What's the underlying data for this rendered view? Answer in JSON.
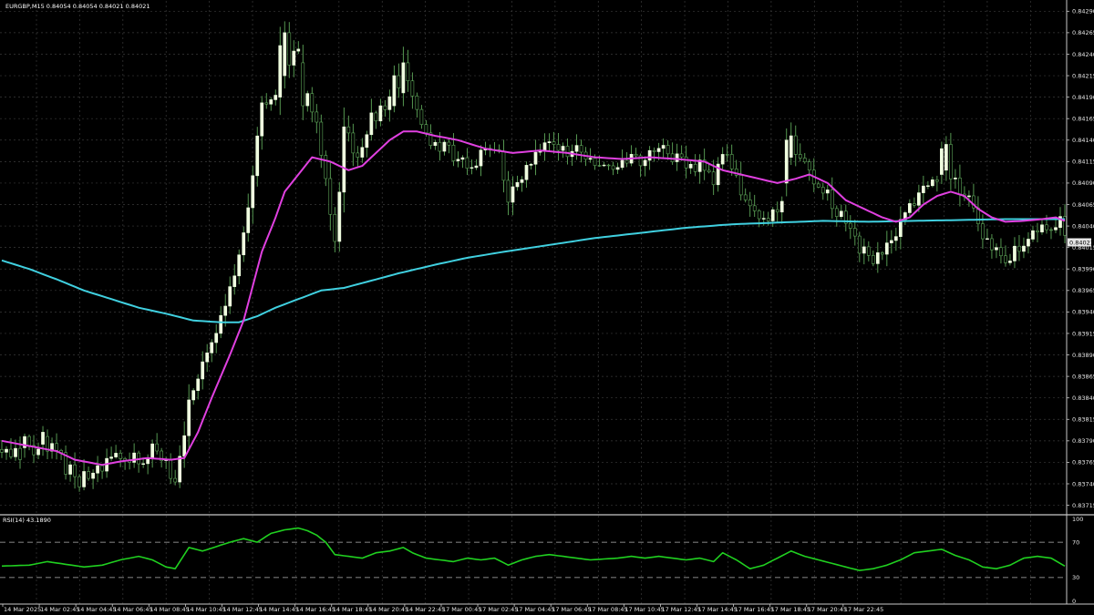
{
  "header": {
    "symbol_info": "EURGBP,M15  0.84054 0.84054 0.84021 0.84021",
    "rsi_info": "RSI(14) 43.1890"
  },
  "colors": {
    "background": "#000000",
    "grid": "#3a3a3a",
    "frame": "#c8c8c8",
    "candle": "#f0ffe0",
    "candle_outline": "#5fa85a",
    "ma_fast": "#e040e0",
    "ma_slow": "#40d0e0",
    "rsi_line": "#20d020",
    "rsi_level": "#b4b4b4",
    "price_marker": "#e6e6e6"
  },
  "chart_data": [
    {
      "type": "candlestick",
      "symbol": "EURGBP",
      "timeframe": "M15",
      "ylim": [
        0.83705,
        0.84302
      ],
      "y_ticks": [
        "0.84290",
        "0.84265",
        "0.84240",
        "0.84215",
        "0.84190",
        "0.84165",
        "0.84140",
        "0.84115",
        "0.84090",
        "0.84065",
        "0.84040",
        "0.84015",
        "0.83990",
        "0.83965",
        "0.83940",
        "0.83915",
        "0.83890",
        "0.83865",
        "0.83840",
        "0.83815",
        "0.83790",
        "0.83765",
        "0.83740",
        "0.83715"
      ],
      "current_price": "0.84021",
      "x_labels": [
        "14 Mar 2025",
        "14 Mar 02:45",
        "14 Mar 04:45",
        "14 Mar 06:45",
        "14 Mar 08:45",
        "14 Mar 10:45",
        "14 Mar 12:45",
        "14 Mar 14:45",
        "14 Mar 16:45",
        "14 Mar 18:45",
        "14 Mar 20:45",
        "14 Mar 22:45",
        "17 Mar 00:45",
        "17 Mar 02:45",
        "17 Mar 04:45",
        "17 Mar 06:45",
        "17 Mar 08:45",
        "17 Mar 10:45",
        "17 Mar 12:45",
        "17 Mar 14:45",
        "17 Mar 16:45",
        "17 Mar 18:45",
        "17 Mar 20:45",
        "17 Mar 22:45"
      ],
      "price_path": [
        [
          0,
          0.8378
        ],
        [
          4,
          0.8377
        ],
        [
          8,
          0.83785
        ],
        [
          11,
          0.8379
        ],
        [
          14,
          0.8376
        ],
        [
          17,
          0.83745
        ],
        [
          21,
          0.83755
        ],
        [
          24,
          0.83772
        ],
        [
          27,
          0.8377
        ],
        [
          30,
          0.83768
        ],
        [
          33,
          0.83778
        ],
        [
          36,
          0.8376
        ],
        [
          38,
          0.83748
        ],
        [
          41,
          0.8383
        ],
        [
          44,
          0.8388
        ],
        [
          47,
          0.8392
        ],
        [
          50,
          0.83965
        ],
        [
          53,
          0.8403
        ],
        [
          55,
          0.841
        ],
        [
          57,
          0.8418
        ],
        [
          60,
          0.842
        ],
        [
          63,
          0.84225
        ],
        [
          65,
          0.8425
        ],
        [
          67,
          0.8419
        ],
        [
          69,
          0.8416
        ],
        [
          71,
          0.8409
        ],
        [
          73,
          0.8402
        ],
        [
          75,
          0.8415
        ],
        [
          78,
          0.8412
        ],
        [
          81,
          0.84165
        ],
        [
          84,
          0.8418
        ],
        [
          87,
          0.842
        ],
        [
          89,
          0.8421
        ],
        [
          91,
          0.8417
        ],
        [
          94,
          0.8414
        ],
        [
          97,
          0.8413
        ],
        [
          100,
          0.8412
        ],
        [
          103,
          0.841
        ],
        [
          106,
          0.8413
        ],
        [
          109,
          0.8412
        ],
        [
          111,
          0.8407
        ],
        [
          114,
          0.841
        ],
        [
          117,
          0.8413
        ],
        [
          120,
          0.8414
        ],
        [
          123,
          0.8413
        ],
        [
          126,
          0.84125
        ],
        [
          129,
          0.8411
        ],
        [
          132,
          0.84105
        ],
        [
          135,
          0.84112
        ],
        [
          138,
          0.8412
        ],
        [
          141,
          0.84115
        ],
        [
          144,
          0.84128
        ],
        [
          147,
          0.8412
        ],
        [
          150,
          0.84112
        ],
        [
          153,
          0.84108
        ],
        [
          156,
          0.84095
        ],
        [
          159,
          0.8413
        ],
        [
          162,
          0.8408
        ],
        [
          165,
          0.8406
        ],
        [
          168,
          0.8405
        ],
        [
          171,
          0.8407
        ],
        [
          174,
          0.8412
        ],
        [
          177,
          0.841
        ],
        [
          180,
          0.8408
        ],
        [
          183,
          0.8406
        ],
        [
          186,
          0.8403
        ],
        [
          189,
          0.8401
        ],
        [
          192,
          0.84
        ],
        [
          195,
          0.8402
        ],
        [
          198,
          0.8405
        ],
        [
          201,
          0.8408
        ],
        [
          204,
          0.8409
        ],
        [
          207,
          0.8411
        ],
        [
          210,
          0.8408
        ],
        [
          213,
          0.8406
        ],
        [
          216,
          0.8402
        ],
        [
          219,
          0.84
        ],
        [
          222,
          0.8401
        ],
        [
          225,
          0.8403
        ],
        [
          228,
          0.8404
        ],
        [
          230,
          0.84035
        ],
        [
          232,
          0.8405
        ],
        [
          233,
          0.84021
        ]
      ],
      "ma_fast_path": [
        [
          0,
          0.8379
        ],
        [
          8,
          0.83782
        ],
        [
          12,
          0.83778
        ],
        [
          16,
          0.83768
        ],
        [
          22,
          0.83762
        ],
        [
          26,
          0.83766
        ],
        [
          32,
          0.8377
        ],
        [
          37,
          0.83768
        ],
        [
          40,
          0.8377
        ],
        [
          43,
          0.838
        ],
        [
          46,
          0.8384
        ],
        [
          50,
          0.8389
        ],
        [
          53,
          0.8393
        ],
        [
          55,
          0.8397
        ],
        [
          57,
          0.8401
        ],
        [
          60,
          0.8405
        ],
        [
          62,
          0.8408
        ],
        [
          65,
          0.841
        ],
        [
          68,
          0.8412
        ],
        [
          72,
          0.84115
        ],
        [
          76,
          0.84105
        ],
        [
          79,
          0.8411
        ],
        [
          82,
          0.84125
        ],
        [
          85,
          0.8414
        ],
        [
          88,
          0.8415
        ],
        [
          91,
          0.8415
        ],
        [
          95,
          0.84145
        ],
        [
          100,
          0.8414
        ],
        [
          106,
          0.8413
        ],
        [
          112,
          0.84125
        ],
        [
          118,
          0.84128
        ],
        [
          124,
          0.84125
        ],
        [
          130,
          0.8412
        ],
        [
          136,
          0.84118
        ],
        [
          142,
          0.8412
        ],
        [
          148,
          0.84118
        ],
        [
          154,
          0.84115
        ],
        [
          158,
          0.84105
        ],
        [
          162,
          0.841
        ],
        [
          166,
          0.84095
        ],
        [
          170,
          0.8409
        ],
        [
          174,
          0.84095
        ],
        [
          177,
          0.841
        ],
        [
          181,
          0.8409
        ],
        [
          185,
          0.8407
        ],
        [
          189,
          0.8406
        ],
        [
          193,
          0.8405
        ],
        [
          196,
          0.84045
        ],
        [
          199,
          0.8405
        ],
        [
          202,
          0.84065
        ],
        [
          205,
          0.84075
        ],
        [
          208,
          0.8408
        ],
        [
          211,
          0.84075
        ],
        [
          214,
          0.8406
        ],
        [
          217,
          0.8405
        ],
        [
          220,
          0.84045
        ],
        [
          224,
          0.84046
        ],
        [
          228,
          0.84048
        ],
        [
          231,
          0.8405
        ],
        [
          233,
          0.84046
        ]
      ],
      "ma_slow_path": [
        [
          0,
          0.84
        ],
        [
          6,
          0.8399
        ],
        [
          12,
          0.83978
        ],
        [
          18,
          0.83965
        ],
        [
          24,
          0.83955
        ],
        [
          30,
          0.83945
        ],
        [
          36,
          0.83938
        ],
        [
          42,
          0.8393
        ],
        [
          48,
          0.83928
        ],
        [
          52,
          0.83928
        ],
        [
          56,
          0.83935
        ],
        [
          60,
          0.83945
        ],
        [
          65,
          0.83955
        ],
        [
          70,
          0.83965
        ],
        [
          75,
          0.83968
        ],
        [
          80,
          0.83975
        ],
        [
          87,
          0.83985
        ],
        [
          95,
          0.83995
        ],
        [
          102,
          0.84003
        ],
        [
          110,
          0.8401
        ],
        [
          120,
          0.84018
        ],
        [
          130,
          0.84026
        ],
        [
          140,
          0.84032
        ],
        [
          150,
          0.84038
        ],
        [
          160,
          0.84042
        ],
        [
          170,
          0.84044
        ],
        [
          180,
          0.84046
        ],
        [
          190,
          0.84045
        ],
        [
          200,
          0.84046
        ],
        [
          210,
          0.84047
        ],
        [
          220,
          0.84048
        ],
        [
          233,
          0.84048
        ]
      ],
      "candles": [
        {
          "i": 5,
          "o": 0.83782,
          "c": 0.83795
        },
        {
          "i": 9,
          "o": 0.83786,
          "c": 0.838
        },
        {
          "i": 10,
          "o": 0.83795,
          "c": 0.83778
        },
        {
          "i": 61,
          "o": 0.8419,
          "c": 0.8425
        },
        {
          "i": 62,
          "o": 0.84215,
          "c": 0.84265
        },
        {
          "i": 66,
          "o": 0.8423,
          "c": 0.8418
        },
        {
          "i": 86,
          "o": 0.8418,
          "c": 0.84215
        },
        {
          "i": 88,
          "o": 0.84195,
          "c": 0.8423
        },
        {
          "i": 172,
          "o": 0.8409,
          "c": 0.8414
        },
        {
          "i": 173,
          "o": 0.8412,
          "c": 0.84145
        },
        {
          "i": 206,
          "o": 0.841,
          "c": 0.8413
        },
        {
          "i": 207,
          "o": 0.84105,
          "c": 0.84135
        }
      ]
    },
    {
      "type": "line",
      "name": "RSI(14)",
      "ylim": [
        0,
        100
      ],
      "y_ticks": [
        "100",
        "70",
        "30",
        "0"
      ],
      "levels": [
        70,
        30
      ],
      "values": [
        [
          0,
          43
        ],
        [
          6,
          44
        ],
        [
          10,
          48
        ],
        [
          14,
          45
        ],
        [
          18,
          42
        ],
        [
          22,
          44
        ],
        [
          26,
          50
        ],
        [
          30,
          54
        ],
        [
          33,
          50
        ],
        [
          36,
          42
        ],
        [
          38,
          40
        ],
        [
          41,
          64
        ],
        [
          44,
          60
        ],
        [
          47,
          65
        ],
        [
          50,
          70
        ],
        [
          53,
          74
        ],
        [
          56,
          70
        ],
        [
          59,
          80
        ],
        [
          62,
          84
        ],
        [
          65,
          86
        ],
        [
          67,
          83
        ],
        [
          69,
          78
        ],
        [
          71,
          70
        ],
        [
          73,
          56
        ],
        [
          76,
          54
        ],
        [
          79,
          52
        ],
        [
          82,
          58
        ],
        [
          85,
          60
        ],
        [
          88,
          64
        ],
        [
          90,
          58
        ],
        [
          93,
          52
        ],
        [
          96,
          50
        ],
        [
          99,
          48
        ],
        [
          102,
          52
        ],
        [
          105,
          50
        ],
        [
          108,
          52
        ],
        [
          111,
          44
        ],
        [
          114,
          50
        ],
        [
          117,
          54
        ],
        [
          120,
          56
        ],
        [
          123,
          54
        ],
        [
          126,
          52
        ],
        [
          129,
          50
        ],
        [
          132,
          51
        ],
        [
          135,
          52
        ],
        [
          138,
          54
        ],
        [
          141,
          52
        ],
        [
          144,
          54
        ],
        [
          147,
          52
        ],
        [
          150,
          50
        ],
        [
          153,
          52
        ],
        [
          156,
          48
        ],
        [
          158,
          58
        ],
        [
          161,
          50
        ],
        [
          164,
          40
        ],
        [
          167,
          44
        ],
        [
          170,
          52
        ],
        [
          173,
          60
        ],
        [
          176,
          54
        ],
        [
          179,
          50
        ],
        [
          182,
          46
        ],
        [
          185,
          42
        ],
        [
          188,
          38
        ],
        [
          191,
          40
        ],
        [
          194,
          44
        ],
        [
          197,
          50
        ],
        [
          200,
          58
        ],
        [
          203,
          60
        ],
        [
          206,
          62
        ],
        [
          209,
          55
        ],
        [
          212,
          50
        ],
        [
          215,
          42
        ],
        [
          218,
          40
        ],
        [
          221,
          44
        ],
        [
          224,
          52
        ],
        [
          227,
          54
        ],
        [
          230,
          52
        ],
        [
          233,
          43
        ]
      ]
    }
  ]
}
